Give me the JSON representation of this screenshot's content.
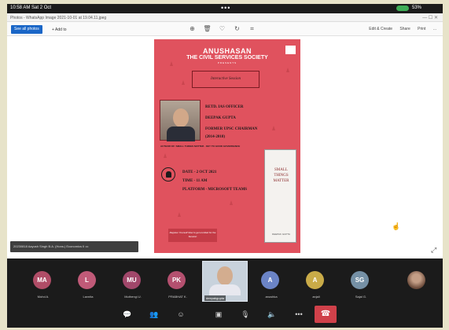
{
  "status_bar": {
    "time": "10:58 AM  Sat 2 Oct",
    "dots": "•••",
    "battery": "53%"
  },
  "window": {
    "title": "Photos - WhatsApp Image 2021-10-01 at 19.04.11.jpeg"
  },
  "toolbar": {
    "see_all_photos": "See all photos",
    "add_to": "+ Add to",
    "icons": [
      "zoom-in-icon",
      "delete-icon",
      "heart-icon",
      "rotate-icon",
      "crop-icon"
    ],
    "edit_create": "Edit & Create",
    "share": "Share",
    "print": "Print",
    "more": "..."
  },
  "poster": {
    "title": "ANUSHASAN",
    "subtitle": "THE CIVIL SERVICES SOCIETY",
    "presents": "PRESENTS",
    "session": "Interactive Session",
    "speaker_line1": "RETD. IAS OFFICER",
    "speaker_name": "DEEPAK GUPTA",
    "speaker_line3": "FORMER UPSC CHAIRMAN",
    "speaker_line4": "(2014-2018)",
    "author_line": "AUTHOR OF:  SMALL THINGS MATTER - KEY TO GOOD GOVERNANCE",
    "date": "DATE - 2 OCT 2021",
    "time": "TIME - 11 AM",
    "platform": "PLATFORM - MICROSOFT TEAMS",
    "book_title": "SMALL THINGS MATTER",
    "book_author": "DEEPAK GUPTA",
    "register": "Register Yourself Now to get enrolled for the Session",
    "accent_color": "#e0525e"
  },
  "share_info": "20230818 Aayush Singh B.A. (Hons.) Economics II   •••",
  "participants": [
    {
      "initials": "MA",
      "name": "Mohd A.",
      "color": "#b04d67"
    },
    {
      "initials": "L",
      "name": "Lavnita",
      "color": "#c05a78"
    },
    {
      "initials": "MU",
      "name": "Muthengi U.",
      "color": "#a1476a"
    },
    {
      "initials": "PK",
      "name": "PRABHAT K.",
      "color": "#b4506f"
    },
    {
      "initials": "",
      "name": "deepakgupta",
      "color": ""
    },
    {
      "initials": "A",
      "name": "anushka",
      "color": "#6b84c6"
    },
    {
      "initials": "A",
      "name": "anjali",
      "color": "#c9ab48"
    },
    {
      "initials": "SG",
      "name": "Sajal G.",
      "color": "#7590a5"
    },
    {
      "initials": "",
      "name": "",
      "color": ""
    }
  ],
  "controls": [
    "chat-icon",
    "people-icon",
    "reactions-icon",
    "camera-icon",
    "mic-icon",
    "speaker-icon",
    "more-icon",
    "end-call-icon"
  ]
}
